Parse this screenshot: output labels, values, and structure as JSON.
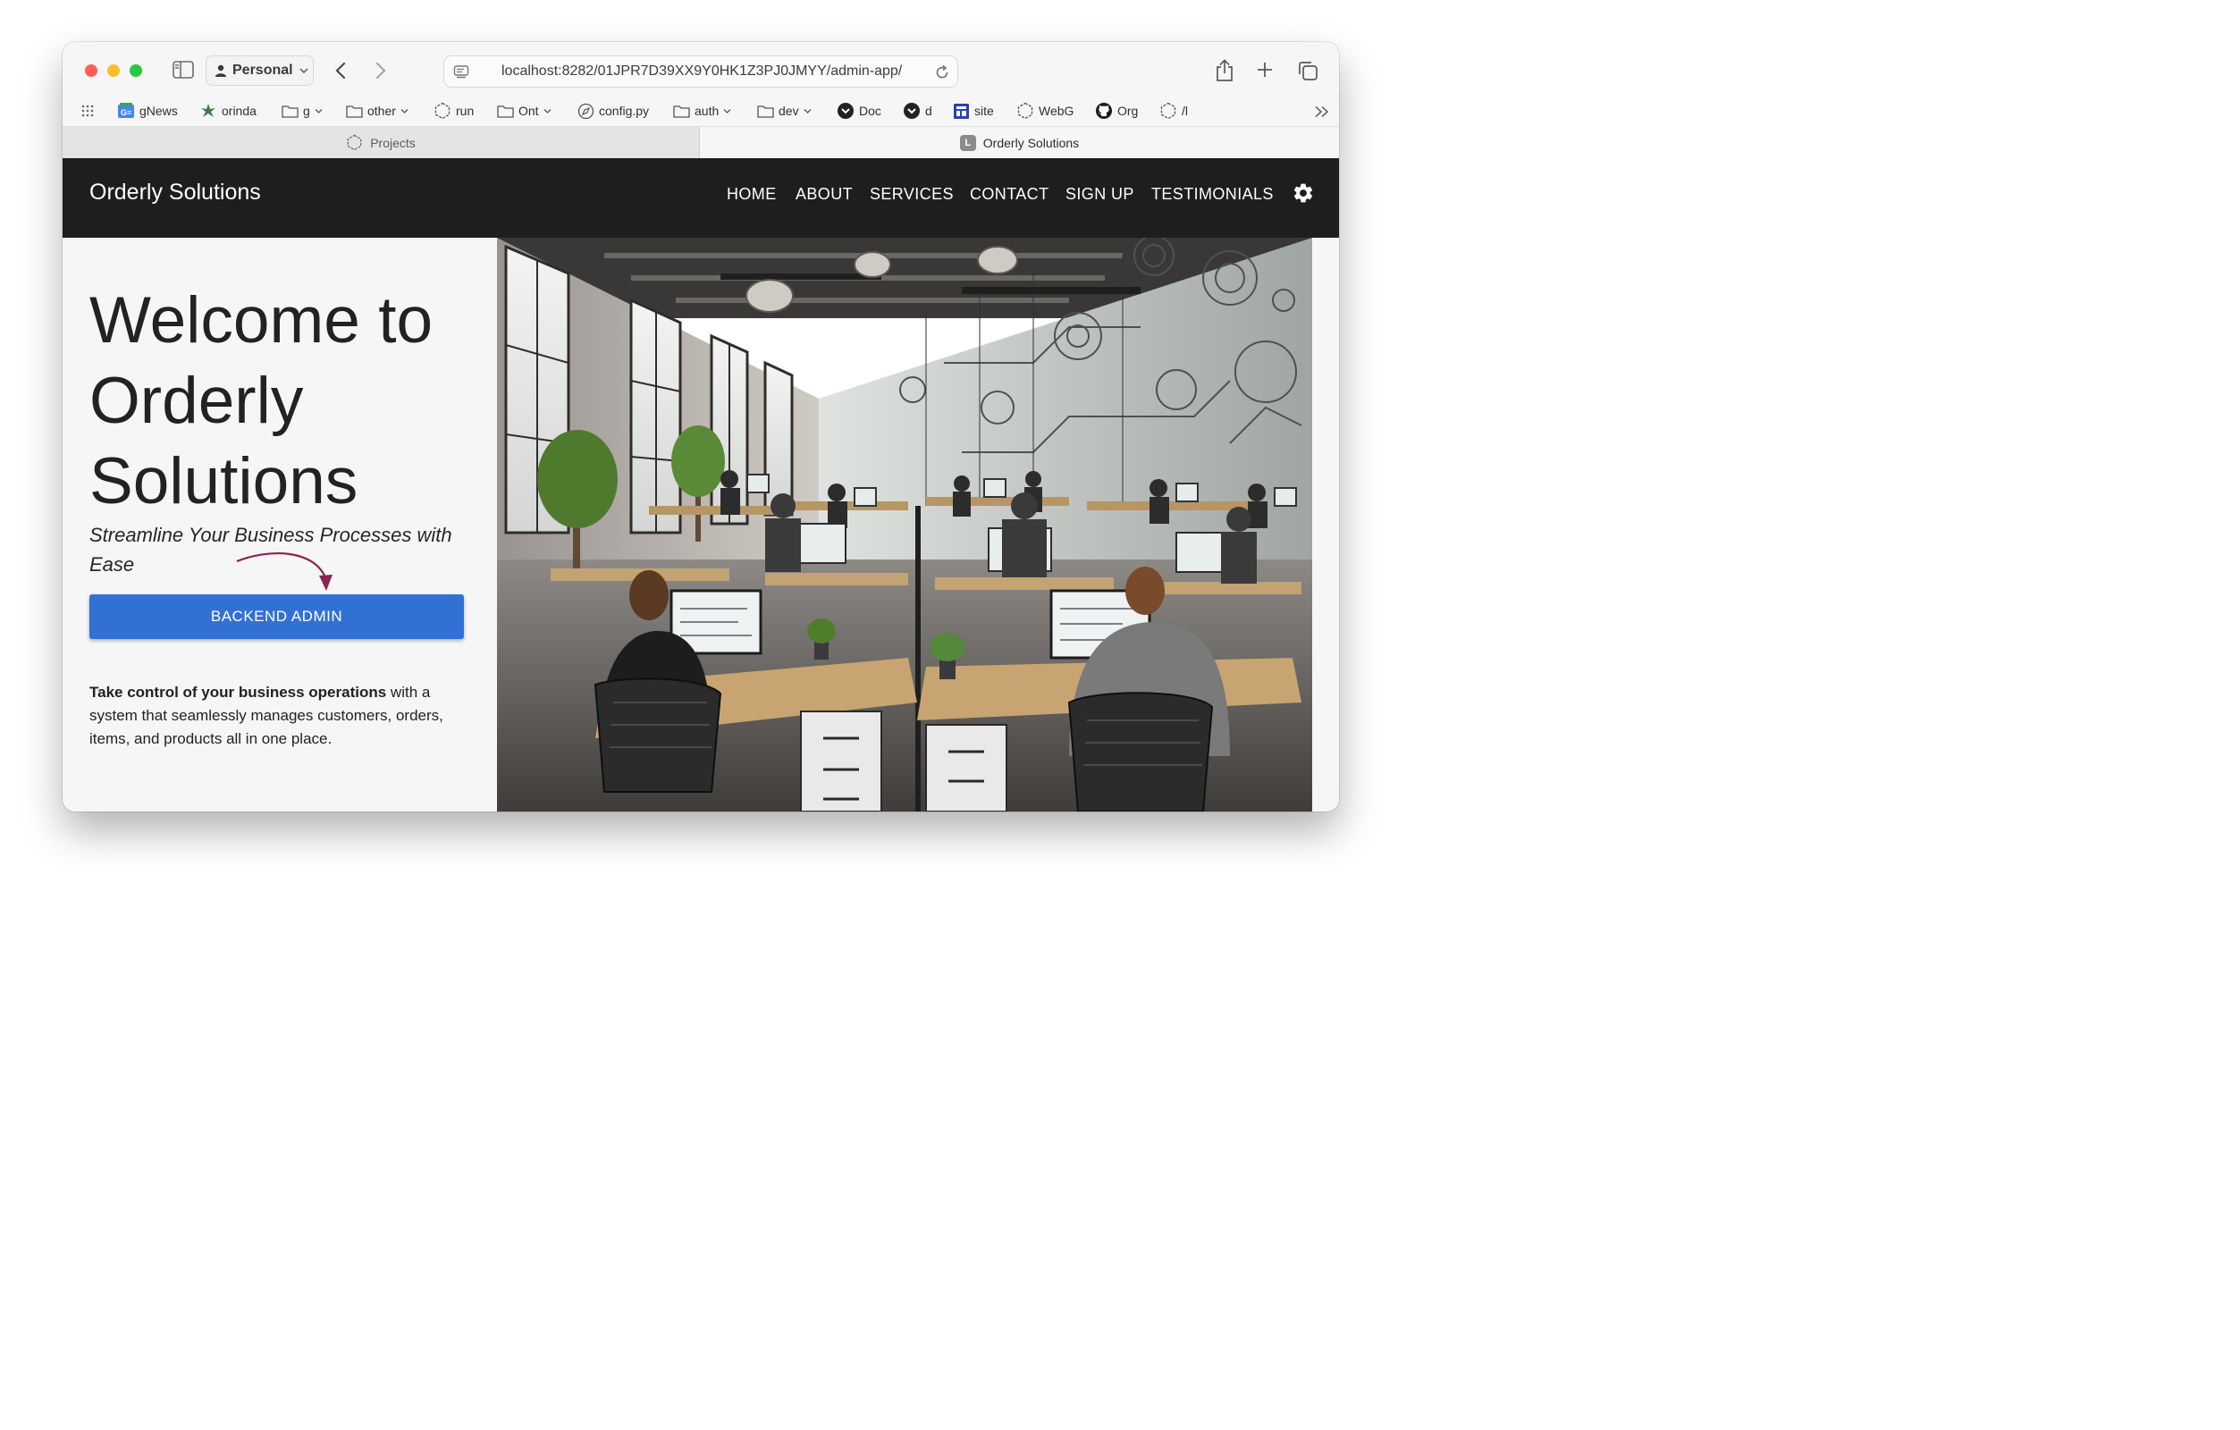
{
  "browser": {
    "profile_label": "Personal",
    "url": "localhost:8282/01JPR7D39XX9Y0HK1Z3PJ0JMYY/admin-app/",
    "bookmarks": [
      {
        "label": "gNews",
        "icon": "gnews-icon"
      },
      {
        "label": "orinda",
        "icon": "leaf-icon"
      },
      {
        "label": "g",
        "icon": "folder-icon",
        "dropdown": true
      },
      {
        "label": "other",
        "icon": "folder-icon",
        "dropdown": true
      },
      {
        "label": "run",
        "icon": "hexagon-icon"
      },
      {
        "label": "Ont",
        "icon": "folder-icon",
        "dropdown": true
      },
      {
        "label": "config.py",
        "icon": "compass-icon"
      },
      {
        "label": "auth",
        "icon": "folder-icon",
        "dropdown": true
      },
      {
        "label": "dev",
        "icon": "folder-icon",
        "dropdown": true
      },
      {
        "label": "Doc",
        "icon": "circle-logo-icon"
      },
      {
        "label": "d",
        "icon": "circle-logo-icon"
      },
      {
        "label": "site",
        "icon": "site-icon"
      },
      {
        "label": "WebG",
        "icon": "hexagon-icon"
      },
      {
        "label": "Org",
        "icon": "github-icon"
      },
      {
        "label": "/l",
        "icon": "hexagon-icon"
      }
    ],
    "tabs": [
      {
        "label": "Projects",
        "active": false
      },
      {
        "label": "Orderly Solutions",
        "active": true,
        "favicon_letter": "L"
      }
    ]
  },
  "site": {
    "brand": "Orderly Solutions",
    "nav": [
      "HOME",
      "ABOUT",
      "SERVICES",
      "CONTACT",
      "SIGN UP",
      "TESTIMONIALS"
    ],
    "hero": {
      "title_line1": "Welcome to",
      "title_line2": "Orderly",
      "title_line3": "Solutions",
      "tagline": "Streamline Your Business Processes with Ease",
      "button_label": "BACKEND ADMIN",
      "body_bold": "Take control of your business operations",
      "body_rest": " with a system that seamlessly manages customers, orders, items, and products all in one place."
    }
  },
  "colors": {
    "header_bg": "#1e1e1e",
    "button_bg": "#3271d4",
    "arrow": "#8b2252"
  }
}
